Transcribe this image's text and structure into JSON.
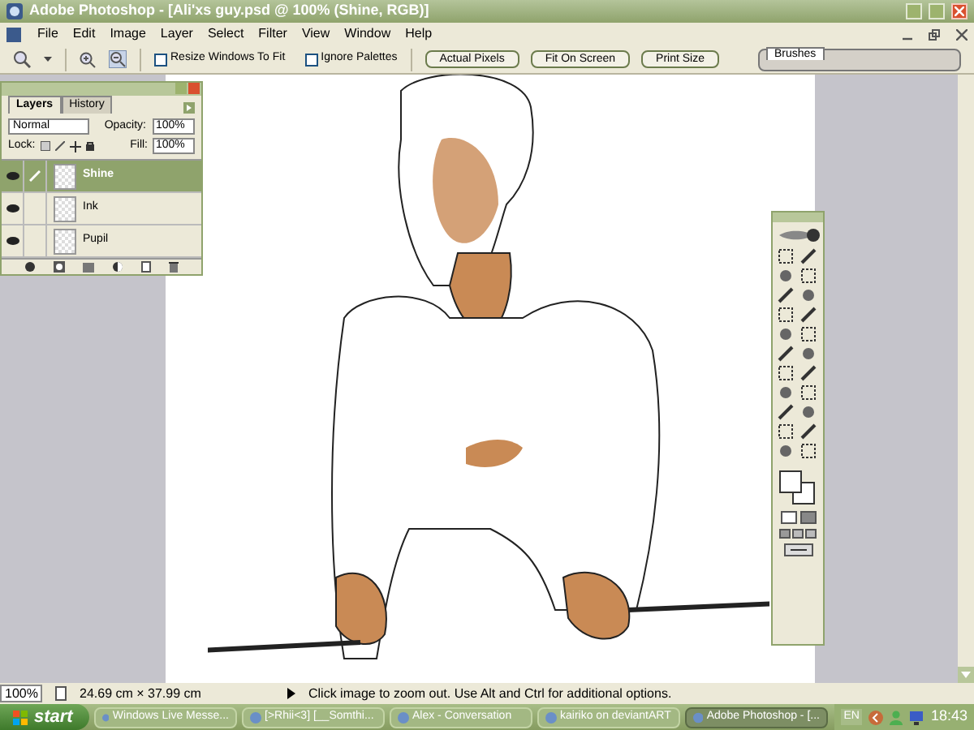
{
  "window": {
    "title": "Adobe Photoshop - [Ali'xs guy.psd @ 100% (Shine, RGB)]"
  },
  "menu": [
    "File",
    "Edit",
    "Image",
    "Layer",
    "Select",
    "Filter",
    "View",
    "Window",
    "Help"
  ],
  "options_bar": {
    "checkboxes": [
      {
        "label": "Resize Windows To Fit",
        "checked": false
      },
      {
        "label": "Ignore Palettes",
        "checked": false
      }
    ],
    "buttons": [
      "Actual Pixels",
      "Fit On Screen",
      "Print Size"
    ]
  },
  "palette_well": {
    "tabs": [
      "Brushes"
    ]
  },
  "layers_panel": {
    "tabs": [
      {
        "label": "Layers",
        "selected": true
      },
      {
        "label": "History",
        "selected": false
      }
    ],
    "blend_mode": "Normal",
    "opacity_label": "Opacity:",
    "opacity": "100%",
    "lock_label": "Lock:",
    "fill_label": "Fill:",
    "fill": "100%",
    "layers": [
      {
        "name": "Shine",
        "selected": true,
        "visible": true,
        "brush": true
      },
      {
        "name": "Ink",
        "selected": false,
        "visible": true,
        "brush": false
      },
      {
        "name": "Pupil",
        "selected": false,
        "visible": true,
        "brush": false
      }
    ]
  },
  "status_bar": {
    "zoom": "100%",
    "doc_size": "24.69 cm × 37.99 cm",
    "hint": "Click image to zoom out. Use Alt and Ctrl for additional options."
  },
  "taskbar": {
    "start": "start",
    "tasks": [
      {
        "label": "Windows Live Messe...",
        "selected": false
      },
      {
        "label": "[>Rhii<3]  [__Somthi...",
        "selected": false
      },
      {
        "label": "Alex - Conversation",
        "selected": false
      },
      {
        "label": "kairiko on deviantART",
        "selected": false
      },
      {
        "label": "Adobe Photoshop - [...",
        "selected": true
      }
    ],
    "language": "EN",
    "clock": "18:43"
  }
}
